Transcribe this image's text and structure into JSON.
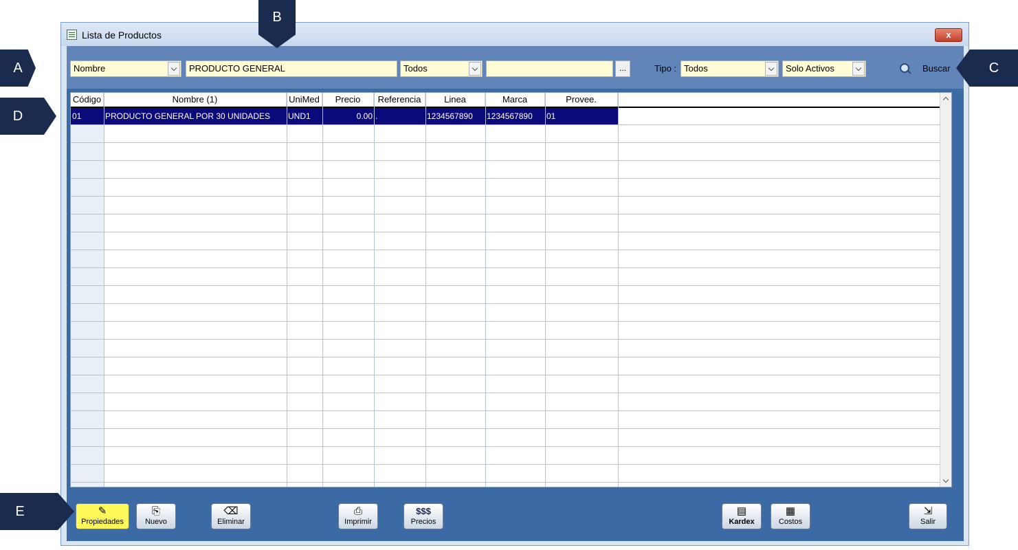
{
  "window": {
    "title": "Lista de Productos",
    "close_label": "x"
  },
  "toolbar": {
    "field_select": "Nombre",
    "search_value": "PRODUCTO GENERAL",
    "filter_select": "Todos",
    "filter_value": "",
    "dots_label": "...",
    "tipo_label": "Tipo :",
    "tipo_value": "Todos",
    "estado_value": "Solo Activos",
    "buscar_label": "Buscar"
  },
  "grid": {
    "columns": [
      "Código",
      "Nombre (1)",
      "UniMed",
      "Precio",
      "Referencia",
      "Linea",
      "Marca",
      "Provee."
    ],
    "rows": [
      {
        "codigo": "01",
        "nombre": "PRODUCTO GENERAL POR 30 UNIDADES",
        "unimed": "UND1",
        "precio": "0.00",
        "referencia": ".",
        "linea": "1234567890",
        "marca": "1234567890",
        "provee": "01"
      }
    ]
  },
  "buttons": {
    "propiedades": "Propiedades",
    "nuevo": "Nuevo",
    "eliminar": "Eliminar",
    "imprimir": "Imprimir",
    "precios_icon": "$$$",
    "precios": "Precios",
    "kardex": "Kardex",
    "costos": "Costos",
    "salir": "Salir"
  },
  "callouts": {
    "a": "A",
    "b": "B",
    "c": "C",
    "d": "D",
    "e": "E"
  }
}
